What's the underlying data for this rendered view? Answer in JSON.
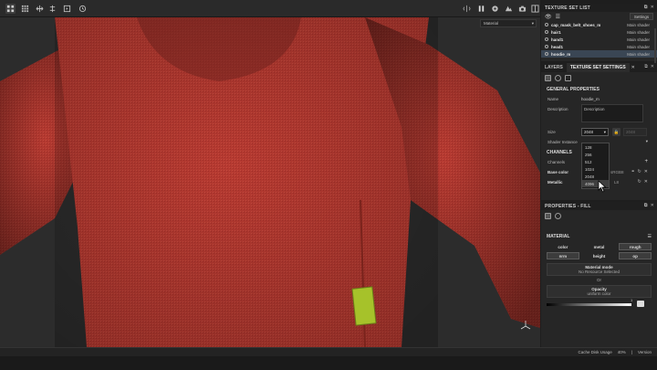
{
  "toolbar": {
    "left_icons": [
      "grid-view-icon",
      "grid-dense-icon",
      "transform-icon",
      "axis-icon",
      "frame-icon",
      "history-icon"
    ],
    "right_icons": [
      "symmetry-icon",
      "pause-icon",
      "camera-icon",
      "render-icon",
      "screenshot-icon",
      "layout-icon"
    ]
  },
  "viewport": {
    "material_select": "Material",
    "colors": {
      "fabric": "#b93c32",
      "background": "#2c2c2c",
      "patch": "#a8c22a"
    }
  },
  "texture_set_list": {
    "title": "TEXTURE SET LIST",
    "settings_label": "Settings",
    "items": [
      {
        "name": "cap_mask_belt_shoes_m",
        "shader": "Main shader",
        "selected": false
      },
      {
        "name": "hair1",
        "shader": "Main shader",
        "selected": false
      },
      {
        "name": "hand1",
        "shader": "Main shader",
        "selected": false
      },
      {
        "name": "head1",
        "shader": "Main shader",
        "selected": false
      },
      {
        "name": "hoodie_m",
        "shader": "Main shader",
        "selected": true
      }
    ]
  },
  "texture_set_settings": {
    "tabs": [
      "LAYERS",
      "TEXTURE SET SETTINGS"
    ],
    "general_title": "GENERAL PROPERTIES",
    "name_label": "Name",
    "name_value": "hoodie_m",
    "description_label": "Description",
    "description_value": "Description",
    "size_label": "Size",
    "size_value": "2048",
    "size_disabled_value": "2048",
    "shader_label": "Shader Instance",
    "channels_title": "CHANNELS",
    "channels_label": "Channels",
    "base_color_label": "Base color",
    "base_color_format": "sRGB8",
    "metallic_label": "Metallic",
    "metallic_format": "L8",
    "size_options": [
      "128",
      "256",
      "512",
      "1024",
      "2048",
      "4096"
    ],
    "hovered_option": "4096"
  },
  "properties_fill": {
    "title": "PROPERTIES - FILL",
    "material_title": "MATERIAL",
    "channels": [
      {
        "label": "color",
        "active": false
      },
      {
        "label": "metal",
        "active": false
      },
      {
        "label": "rough",
        "active": true
      },
      {
        "label": "nrm",
        "active": true
      },
      {
        "label": "height",
        "active": false
      },
      {
        "label": "op",
        "active": true
      }
    ],
    "material_mode_label": "Material mode",
    "material_mode_value": "No Resource Selected",
    "or_label": "Or",
    "opacity_label": "Opacity",
    "opacity_sub": "uniform color",
    "opacity_value": "1"
  },
  "statusbar": {
    "cache_label": "Cache Disk Usage",
    "cache_value": "40%",
    "version_label": "Version"
  }
}
